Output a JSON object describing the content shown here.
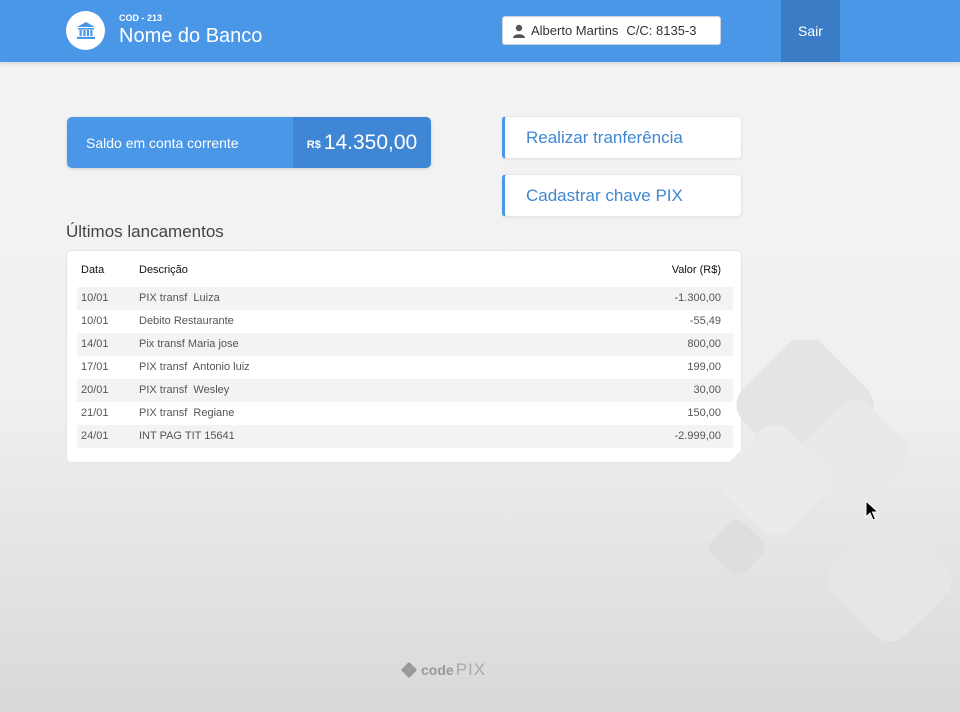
{
  "header": {
    "bank_code": "COD - 213",
    "bank_name": "Nome do Banco",
    "account_holder": "Alberto Martins",
    "account_number": "C/C: 8135-3",
    "logout_label": "Sair",
    "colors": {
      "primary": "#4a97e8",
      "primary_dark": "#3a7cc5"
    },
    "icons": {
      "logo": "bank-icon",
      "user": "user-icon"
    }
  },
  "balance": {
    "label": "Saldo em conta corrente",
    "currency": "R$",
    "value": "14.350,00"
  },
  "actions": {
    "transfer_label": "Realizar tranferência",
    "pix_key_label": "Cadastrar chave PIX"
  },
  "transactions": {
    "title": "Últimos lancamentos",
    "columns": {
      "date": "Data",
      "description": "Descrição",
      "value": "Valor (R$)"
    },
    "rows": [
      {
        "date": "10/01",
        "description": "PIX transf  Luiza",
        "value": "-1.300,00"
      },
      {
        "date": "10/01",
        "description": "Debito Restaurante",
        "value": "-55,49"
      },
      {
        "date": "14/01",
        "description": "Pix transf Maria jose",
        "value": "800,00"
      },
      {
        "date": "17/01",
        "description": "PIX transf  Antonio luiz",
        "value": "199,00"
      },
      {
        "date": "20/01",
        "description": "PIX transf  Wesley",
        "value": "30,00"
      },
      {
        "date": "21/01",
        "description": "PIX transf  Regiane",
        "value": "150,00"
      },
      {
        "date": "24/01",
        "description": "INT PAG TIT 15641",
        "value": "-2.999,00"
      }
    ]
  },
  "footer": {
    "brand_code": "code",
    "brand_pix": "PIX",
    "icon": "codepix-logo-icon"
  }
}
